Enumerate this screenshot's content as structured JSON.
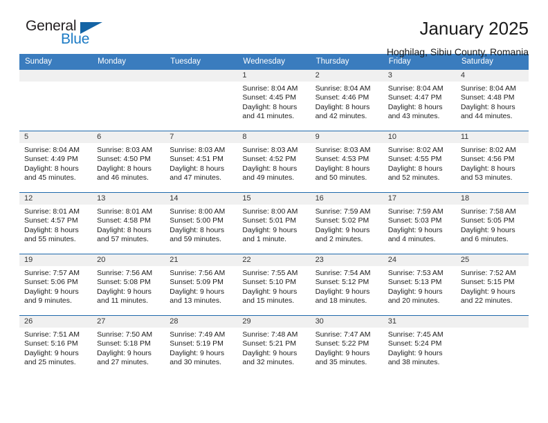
{
  "brand": {
    "name_top": "General",
    "name_bottom": "Blue",
    "accent_color": "#1464a5",
    "text_color": "#231f20"
  },
  "header": {
    "title": "January 2025",
    "subtitle": "Hoghilag, Sibiu County, Romania"
  },
  "theme": {
    "header_row_bg": "#3a7cbe",
    "row_divider": "#1d68ab",
    "date_band_bg": "#f0f0f0",
    "page_bg": "#ffffff"
  },
  "weekdays": [
    "Sunday",
    "Monday",
    "Tuesday",
    "Wednesday",
    "Thursday",
    "Friday",
    "Saturday"
  ],
  "weeks": [
    [
      {
        "day": "",
        "empty": true
      },
      {
        "day": "",
        "empty": true
      },
      {
        "day": "",
        "empty": true
      },
      {
        "day": "1",
        "sunrise": "Sunrise: 8:04 AM",
        "sunset": "Sunset: 4:45 PM",
        "daylight_line1": "Daylight: 8 hours",
        "daylight_line2": "and 41 minutes."
      },
      {
        "day": "2",
        "sunrise": "Sunrise: 8:04 AM",
        "sunset": "Sunset: 4:46 PM",
        "daylight_line1": "Daylight: 8 hours",
        "daylight_line2": "and 42 minutes."
      },
      {
        "day": "3",
        "sunrise": "Sunrise: 8:04 AM",
        "sunset": "Sunset: 4:47 PM",
        "daylight_line1": "Daylight: 8 hours",
        "daylight_line2": "and 43 minutes."
      },
      {
        "day": "4",
        "sunrise": "Sunrise: 8:04 AM",
        "sunset": "Sunset: 4:48 PM",
        "daylight_line1": "Daylight: 8 hours",
        "daylight_line2": "and 44 minutes."
      }
    ],
    [
      {
        "day": "5",
        "sunrise": "Sunrise: 8:04 AM",
        "sunset": "Sunset: 4:49 PM",
        "daylight_line1": "Daylight: 8 hours",
        "daylight_line2": "and 45 minutes."
      },
      {
        "day": "6",
        "sunrise": "Sunrise: 8:03 AM",
        "sunset": "Sunset: 4:50 PM",
        "daylight_line1": "Daylight: 8 hours",
        "daylight_line2": "and 46 minutes."
      },
      {
        "day": "7",
        "sunrise": "Sunrise: 8:03 AM",
        "sunset": "Sunset: 4:51 PM",
        "daylight_line1": "Daylight: 8 hours",
        "daylight_line2": "and 47 minutes."
      },
      {
        "day": "8",
        "sunrise": "Sunrise: 8:03 AM",
        "sunset": "Sunset: 4:52 PM",
        "daylight_line1": "Daylight: 8 hours",
        "daylight_line2": "and 49 minutes."
      },
      {
        "day": "9",
        "sunrise": "Sunrise: 8:03 AM",
        "sunset": "Sunset: 4:53 PM",
        "daylight_line1": "Daylight: 8 hours",
        "daylight_line2": "and 50 minutes."
      },
      {
        "day": "10",
        "sunrise": "Sunrise: 8:02 AM",
        "sunset": "Sunset: 4:55 PM",
        "daylight_line1": "Daylight: 8 hours",
        "daylight_line2": "and 52 minutes."
      },
      {
        "day": "11",
        "sunrise": "Sunrise: 8:02 AM",
        "sunset": "Sunset: 4:56 PM",
        "daylight_line1": "Daylight: 8 hours",
        "daylight_line2": "and 53 minutes."
      }
    ],
    [
      {
        "day": "12",
        "sunrise": "Sunrise: 8:01 AM",
        "sunset": "Sunset: 4:57 PM",
        "daylight_line1": "Daylight: 8 hours",
        "daylight_line2": "and 55 minutes."
      },
      {
        "day": "13",
        "sunrise": "Sunrise: 8:01 AM",
        "sunset": "Sunset: 4:58 PM",
        "daylight_line1": "Daylight: 8 hours",
        "daylight_line2": "and 57 minutes."
      },
      {
        "day": "14",
        "sunrise": "Sunrise: 8:00 AM",
        "sunset": "Sunset: 5:00 PM",
        "daylight_line1": "Daylight: 8 hours",
        "daylight_line2": "and 59 minutes."
      },
      {
        "day": "15",
        "sunrise": "Sunrise: 8:00 AM",
        "sunset": "Sunset: 5:01 PM",
        "daylight_line1": "Daylight: 9 hours",
        "daylight_line2": "and 1 minute."
      },
      {
        "day": "16",
        "sunrise": "Sunrise: 7:59 AM",
        "sunset": "Sunset: 5:02 PM",
        "daylight_line1": "Daylight: 9 hours",
        "daylight_line2": "and 2 minutes."
      },
      {
        "day": "17",
        "sunrise": "Sunrise: 7:59 AM",
        "sunset": "Sunset: 5:03 PM",
        "daylight_line1": "Daylight: 9 hours",
        "daylight_line2": "and 4 minutes."
      },
      {
        "day": "18",
        "sunrise": "Sunrise: 7:58 AM",
        "sunset": "Sunset: 5:05 PM",
        "daylight_line1": "Daylight: 9 hours",
        "daylight_line2": "and 6 minutes."
      }
    ],
    [
      {
        "day": "19",
        "sunrise": "Sunrise: 7:57 AM",
        "sunset": "Sunset: 5:06 PM",
        "daylight_line1": "Daylight: 9 hours",
        "daylight_line2": "and 9 minutes."
      },
      {
        "day": "20",
        "sunrise": "Sunrise: 7:56 AM",
        "sunset": "Sunset: 5:08 PM",
        "daylight_line1": "Daylight: 9 hours",
        "daylight_line2": "and 11 minutes."
      },
      {
        "day": "21",
        "sunrise": "Sunrise: 7:56 AM",
        "sunset": "Sunset: 5:09 PM",
        "daylight_line1": "Daylight: 9 hours",
        "daylight_line2": "and 13 minutes."
      },
      {
        "day": "22",
        "sunrise": "Sunrise: 7:55 AM",
        "sunset": "Sunset: 5:10 PM",
        "daylight_line1": "Daylight: 9 hours",
        "daylight_line2": "and 15 minutes."
      },
      {
        "day": "23",
        "sunrise": "Sunrise: 7:54 AM",
        "sunset": "Sunset: 5:12 PM",
        "daylight_line1": "Daylight: 9 hours",
        "daylight_line2": "and 18 minutes."
      },
      {
        "day": "24",
        "sunrise": "Sunrise: 7:53 AM",
        "sunset": "Sunset: 5:13 PM",
        "daylight_line1": "Daylight: 9 hours",
        "daylight_line2": "and 20 minutes."
      },
      {
        "day": "25",
        "sunrise": "Sunrise: 7:52 AM",
        "sunset": "Sunset: 5:15 PM",
        "daylight_line1": "Daylight: 9 hours",
        "daylight_line2": "and 22 minutes."
      }
    ],
    [
      {
        "day": "26",
        "sunrise": "Sunrise: 7:51 AM",
        "sunset": "Sunset: 5:16 PM",
        "daylight_line1": "Daylight: 9 hours",
        "daylight_line2": "and 25 minutes."
      },
      {
        "day": "27",
        "sunrise": "Sunrise: 7:50 AM",
        "sunset": "Sunset: 5:18 PM",
        "daylight_line1": "Daylight: 9 hours",
        "daylight_line2": "and 27 minutes."
      },
      {
        "day": "28",
        "sunrise": "Sunrise: 7:49 AM",
        "sunset": "Sunset: 5:19 PM",
        "daylight_line1": "Daylight: 9 hours",
        "daylight_line2": "and 30 minutes."
      },
      {
        "day": "29",
        "sunrise": "Sunrise: 7:48 AM",
        "sunset": "Sunset: 5:21 PM",
        "daylight_line1": "Daylight: 9 hours",
        "daylight_line2": "and 32 minutes."
      },
      {
        "day": "30",
        "sunrise": "Sunrise: 7:47 AM",
        "sunset": "Sunset: 5:22 PM",
        "daylight_line1": "Daylight: 9 hours",
        "daylight_line2": "and 35 minutes."
      },
      {
        "day": "31",
        "sunrise": "Sunrise: 7:45 AM",
        "sunset": "Sunset: 5:24 PM",
        "daylight_line1": "Daylight: 9 hours",
        "daylight_line2": "and 38 minutes."
      },
      {
        "day": "",
        "empty": true
      }
    ]
  ]
}
